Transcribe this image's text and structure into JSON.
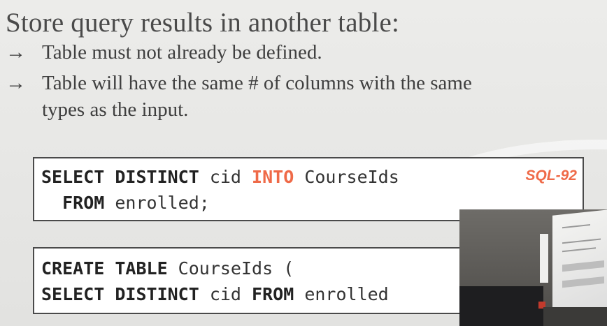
{
  "slide": {
    "heading": "Store query results in another table:",
    "bullets": [
      {
        "arrow": "→",
        "lines": [
          "Table must not already be defined."
        ]
      },
      {
        "arrow": "→",
        "lines": [
          "Table will have the same # of columns with the same",
          "types as the input."
        ]
      }
    ]
  },
  "code_block_1": {
    "badge": "SQL-92",
    "line1": {
      "kw1": "SELECT DISTINCT",
      "t1": " cid ",
      "kw2": "INTO",
      "t2": " CourseIds"
    },
    "line2": {
      "indent": "  ",
      "kw1": "FROM",
      "t1": " enrolled;"
    }
  },
  "code_block_2": {
    "line1": {
      "kw1": "CREATE TABLE",
      "t1": " CourseIds ("
    },
    "line2": {
      "kw1": "SELECT DISTINCT",
      "t1": " cid ",
      "kw2": "FROM",
      "t2": " enrolled"
    }
  },
  "colors": {
    "accent": "#ef6a48",
    "text": "#3a3a3a",
    "background": "#e8e8e6"
  }
}
